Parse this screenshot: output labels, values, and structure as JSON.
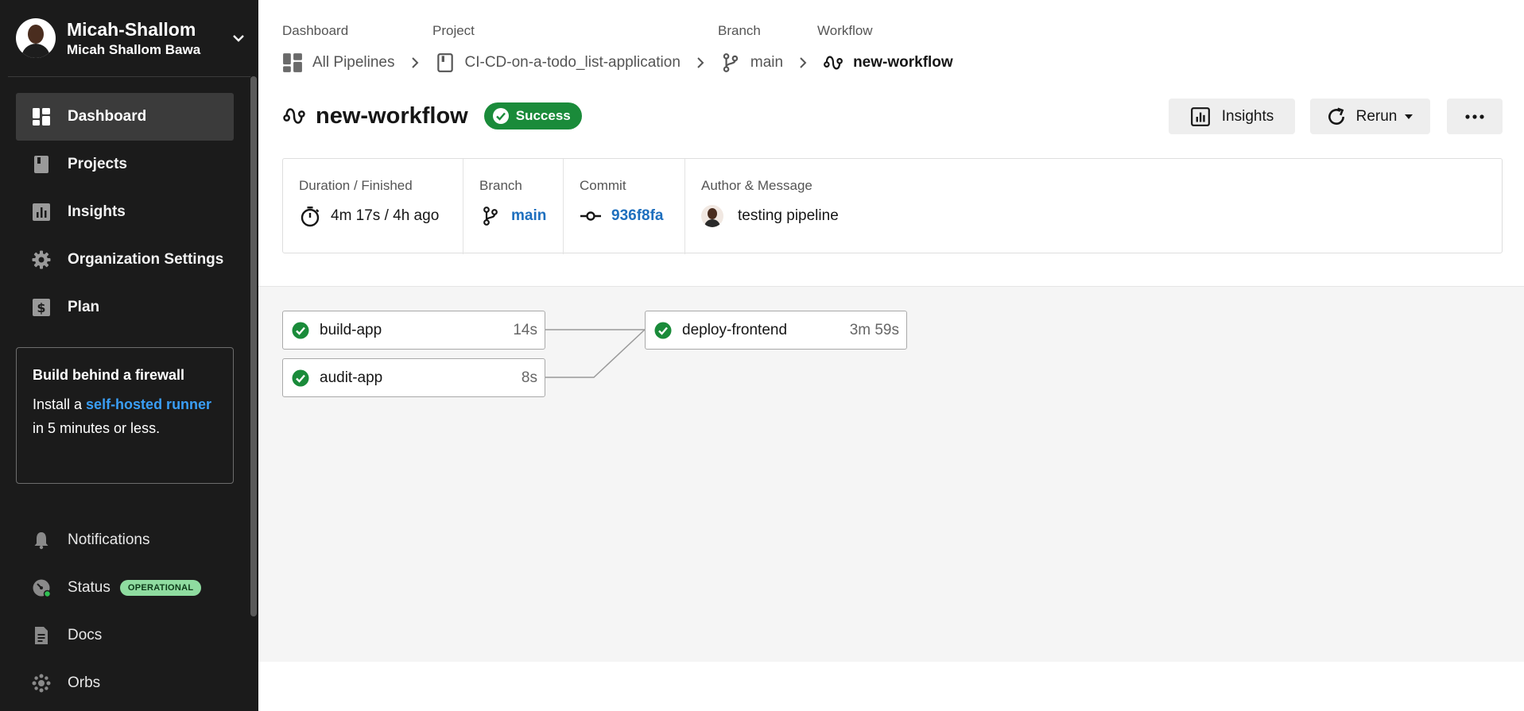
{
  "sidebar": {
    "org_name": "Micah-Shallom",
    "user_name": "Micah Shallom Bawa",
    "nav": [
      {
        "label": "Dashboard",
        "icon": "dashboard-icon",
        "active": true
      },
      {
        "label": "Projects",
        "icon": "projects-icon"
      },
      {
        "label": "Insights",
        "icon": "insights-icon"
      },
      {
        "label": "Organization Settings",
        "icon": "gear-icon"
      },
      {
        "label": "Plan",
        "icon": "plan-icon"
      }
    ],
    "promo": {
      "title": "Build behind a firewall",
      "text_before": "Install a ",
      "link": "self-hosted runner",
      "text_after": " in 5 minutes or less."
    },
    "bottom": [
      {
        "label": "Notifications",
        "icon": "bell-icon"
      },
      {
        "label": "Status",
        "icon": "status-icon",
        "badge": "OPERATIONAL"
      },
      {
        "label": "Docs",
        "icon": "docs-icon"
      },
      {
        "label": "Orbs",
        "icon": "orbs-icon"
      }
    ]
  },
  "breadcrumb": {
    "labels": {
      "dashboard": "Dashboard",
      "project": "Project",
      "branch": "Branch",
      "workflow": "Workflow"
    },
    "items": {
      "pipelines": "All Pipelines",
      "project": "CI-CD-on-a-todo_list-application",
      "branch": "main",
      "workflow": "new-workflow"
    }
  },
  "header": {
    "title": "new-workflow",
    "status": "Success",
    "insights_label": "Insights",
    "rerun_label": "Rerun"
  },
  "info": {
    "duration_label": "Duration / Finished",
    "duration_value": "4m 17s / 4h ago",
    "branch_label": "Branch",
    "branch_value": "main",
    "commit_label": "Commit",
    "commit_value": "936f8fa",
    "author_label": "Author & Message",
    "message": "testing pipeline"
  },
  "jobs": [
    {
      "name": "build-app",
      "duration": "14s",
      "status": "success"
    },
    {
      "name": "audit-app",
      "duration": "8s",
      "status": "success"
    },
    {
      "name": "deploy-frontend",
      "duration": "3m 59s",
      "status": "success"
    }
  ],
  "colors": {
    "sidebar_bg": "#1b1b1b",
    "success": "#1a8b3a",
    "link": "#1e6fbe",
    "promo_link": "#3a9ef5",
    "operational_badge": "#8fdca0"
  }
}
